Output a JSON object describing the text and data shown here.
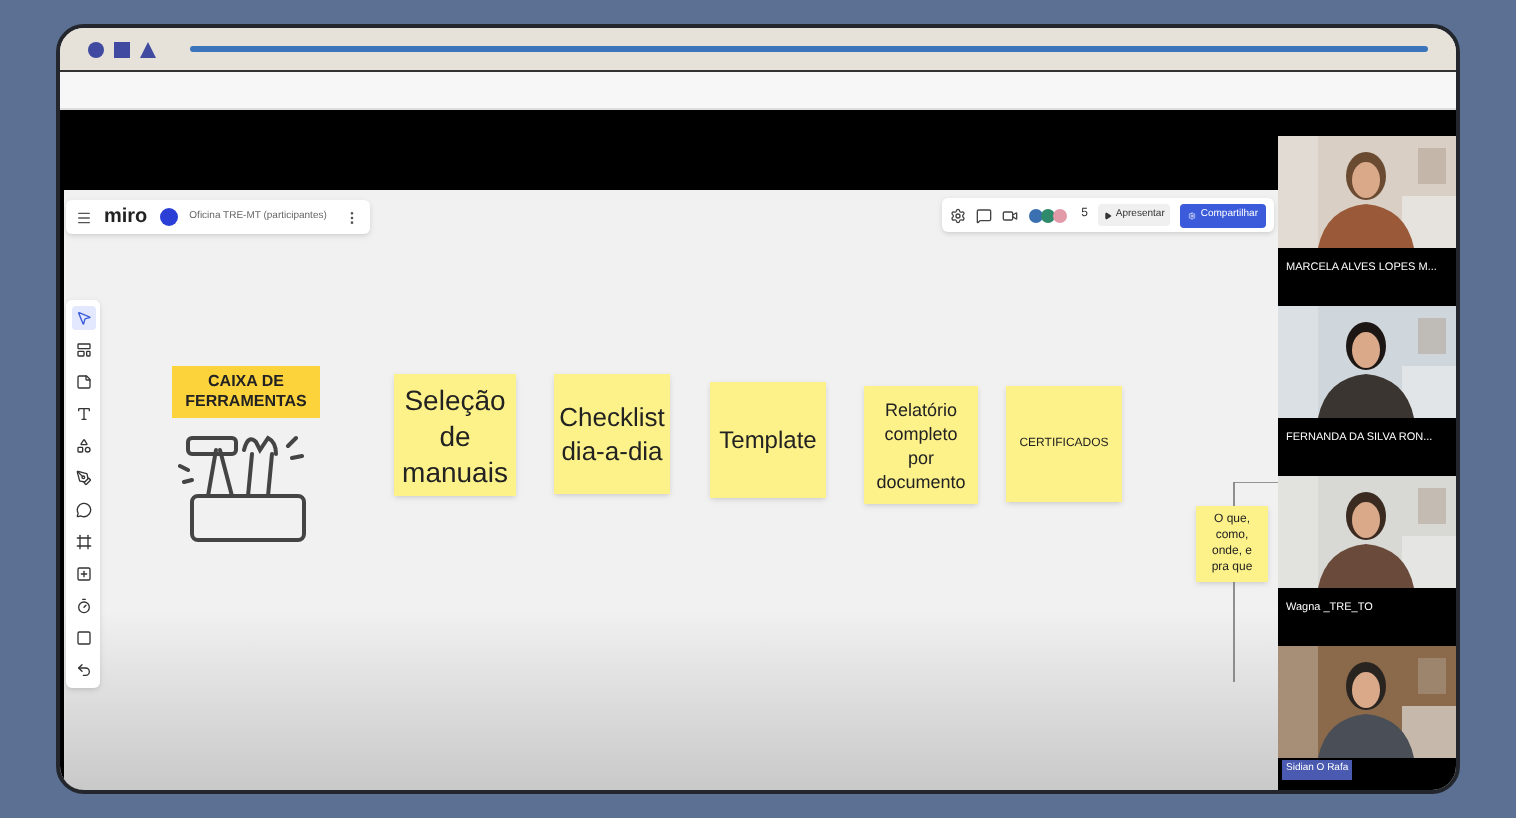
{
  "board": {
    "logo": "miro",
    "title": "Oficina TRE-MT (participantes)",
    "collaborators": "5",
    "present_button": "Apresentar",
    "share_button": "Compartilhar",
    "tools": [
      {
        "kind": "select",
        "selected": true
      },
      {
        "kind": "templates",
        "selected": false
      },
      {
        "kind": "sticky",
        "selected": false
      },
      {
        "kind": "text",
        "selected": false
      },
      {
        "kind": "shapes",
        "selected": false
      },
      {
        "kind": "pen",
        "selected": false
      },
      {
        "kind": "comment",
        "selected": false
      },
      {
        "kind": "frame",
        "selected": false
      },
      {
        "kind": "add",
        "selected": false
      },
      {
        "kind": "timer",
        "selected": false
      },
      {
        "kind": "apps",
        "selected": false
      },
      {
        "kind": "undo",
        "selected": false
      }
    ],
    "label": "CAIXA DE FERRAMENTAS",
    "stickies": [
      {
        "text": "Seleção de manuais"
      },
      {
        "text": "Checklist dia-a-dia"
      },
      {
        "text": "Template"
      },
      {
        "text": "Relatório completo por documento"
      },
      {
        "text": "CERTIFICADOS"
      },
      {
        "text": "O que, como, onde, e pra que"
      }
    ]
  },
  "participants": [
    {
      "name": "MARCELA ALVES LOPES M..."
    },
    {
      "name": "FERNANDA DA SILVA RON..."
    },
    {
      "name": "Wagna _TRE_TO"
    },
    {
      "name": "Sidian O Rafa"
    }
  ]
}
